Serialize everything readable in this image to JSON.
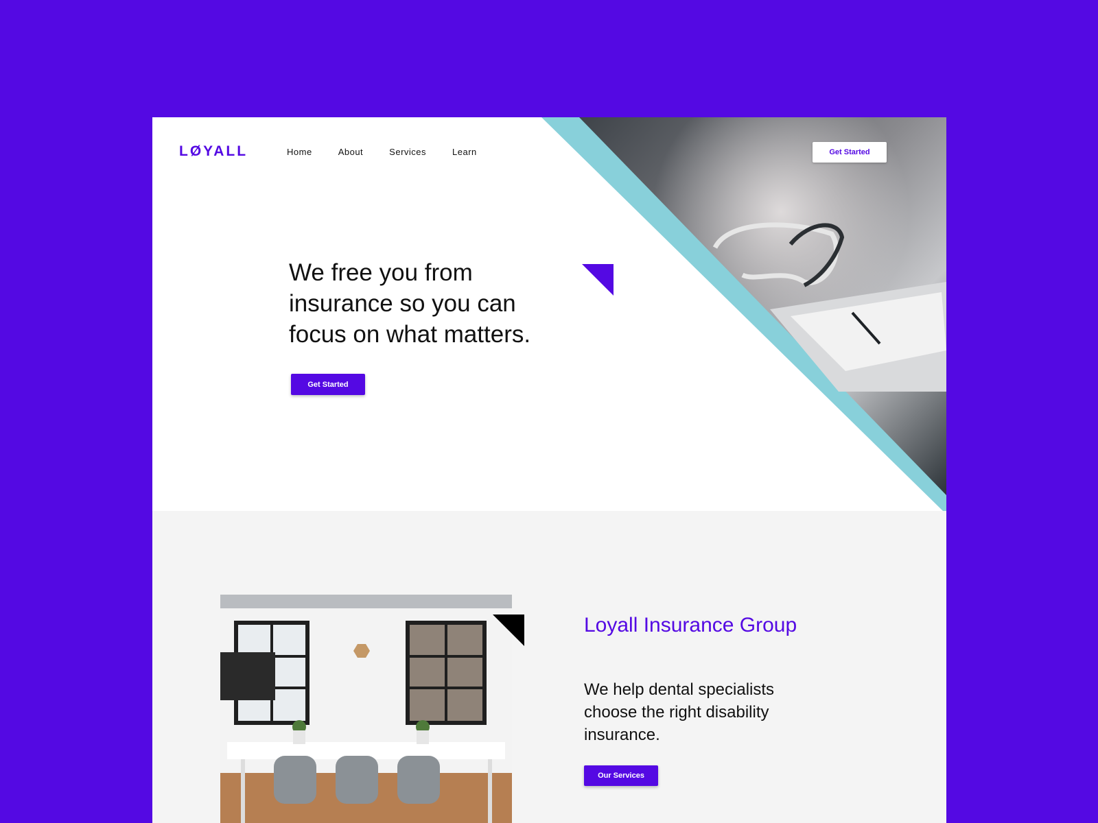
{
  "brand": {
    "logo": "LØYALL",
    "accent_color": "#5409e3",
    "stripe_color": "#88d0da"
  },
  "nav": {
    "items": [
      "Home",
      "About",
      "Services",
      "Learn"
    ],
    "cta_label": "Get Started"
  },
  "hero": {
    "headline": "We free you from insurance so you can focus on what matters.",
    "cta_label": "Get Started"
  },
  "about": {
    "title": "Loyall Insurance Group",
    "text": "We help dental specialists choose the right disability insurance.",
    "cta_label": "Our Services"
  },
  "icons": [
    "accent-triangle-icon",
    "black-triangle-icon"
  ]
}
